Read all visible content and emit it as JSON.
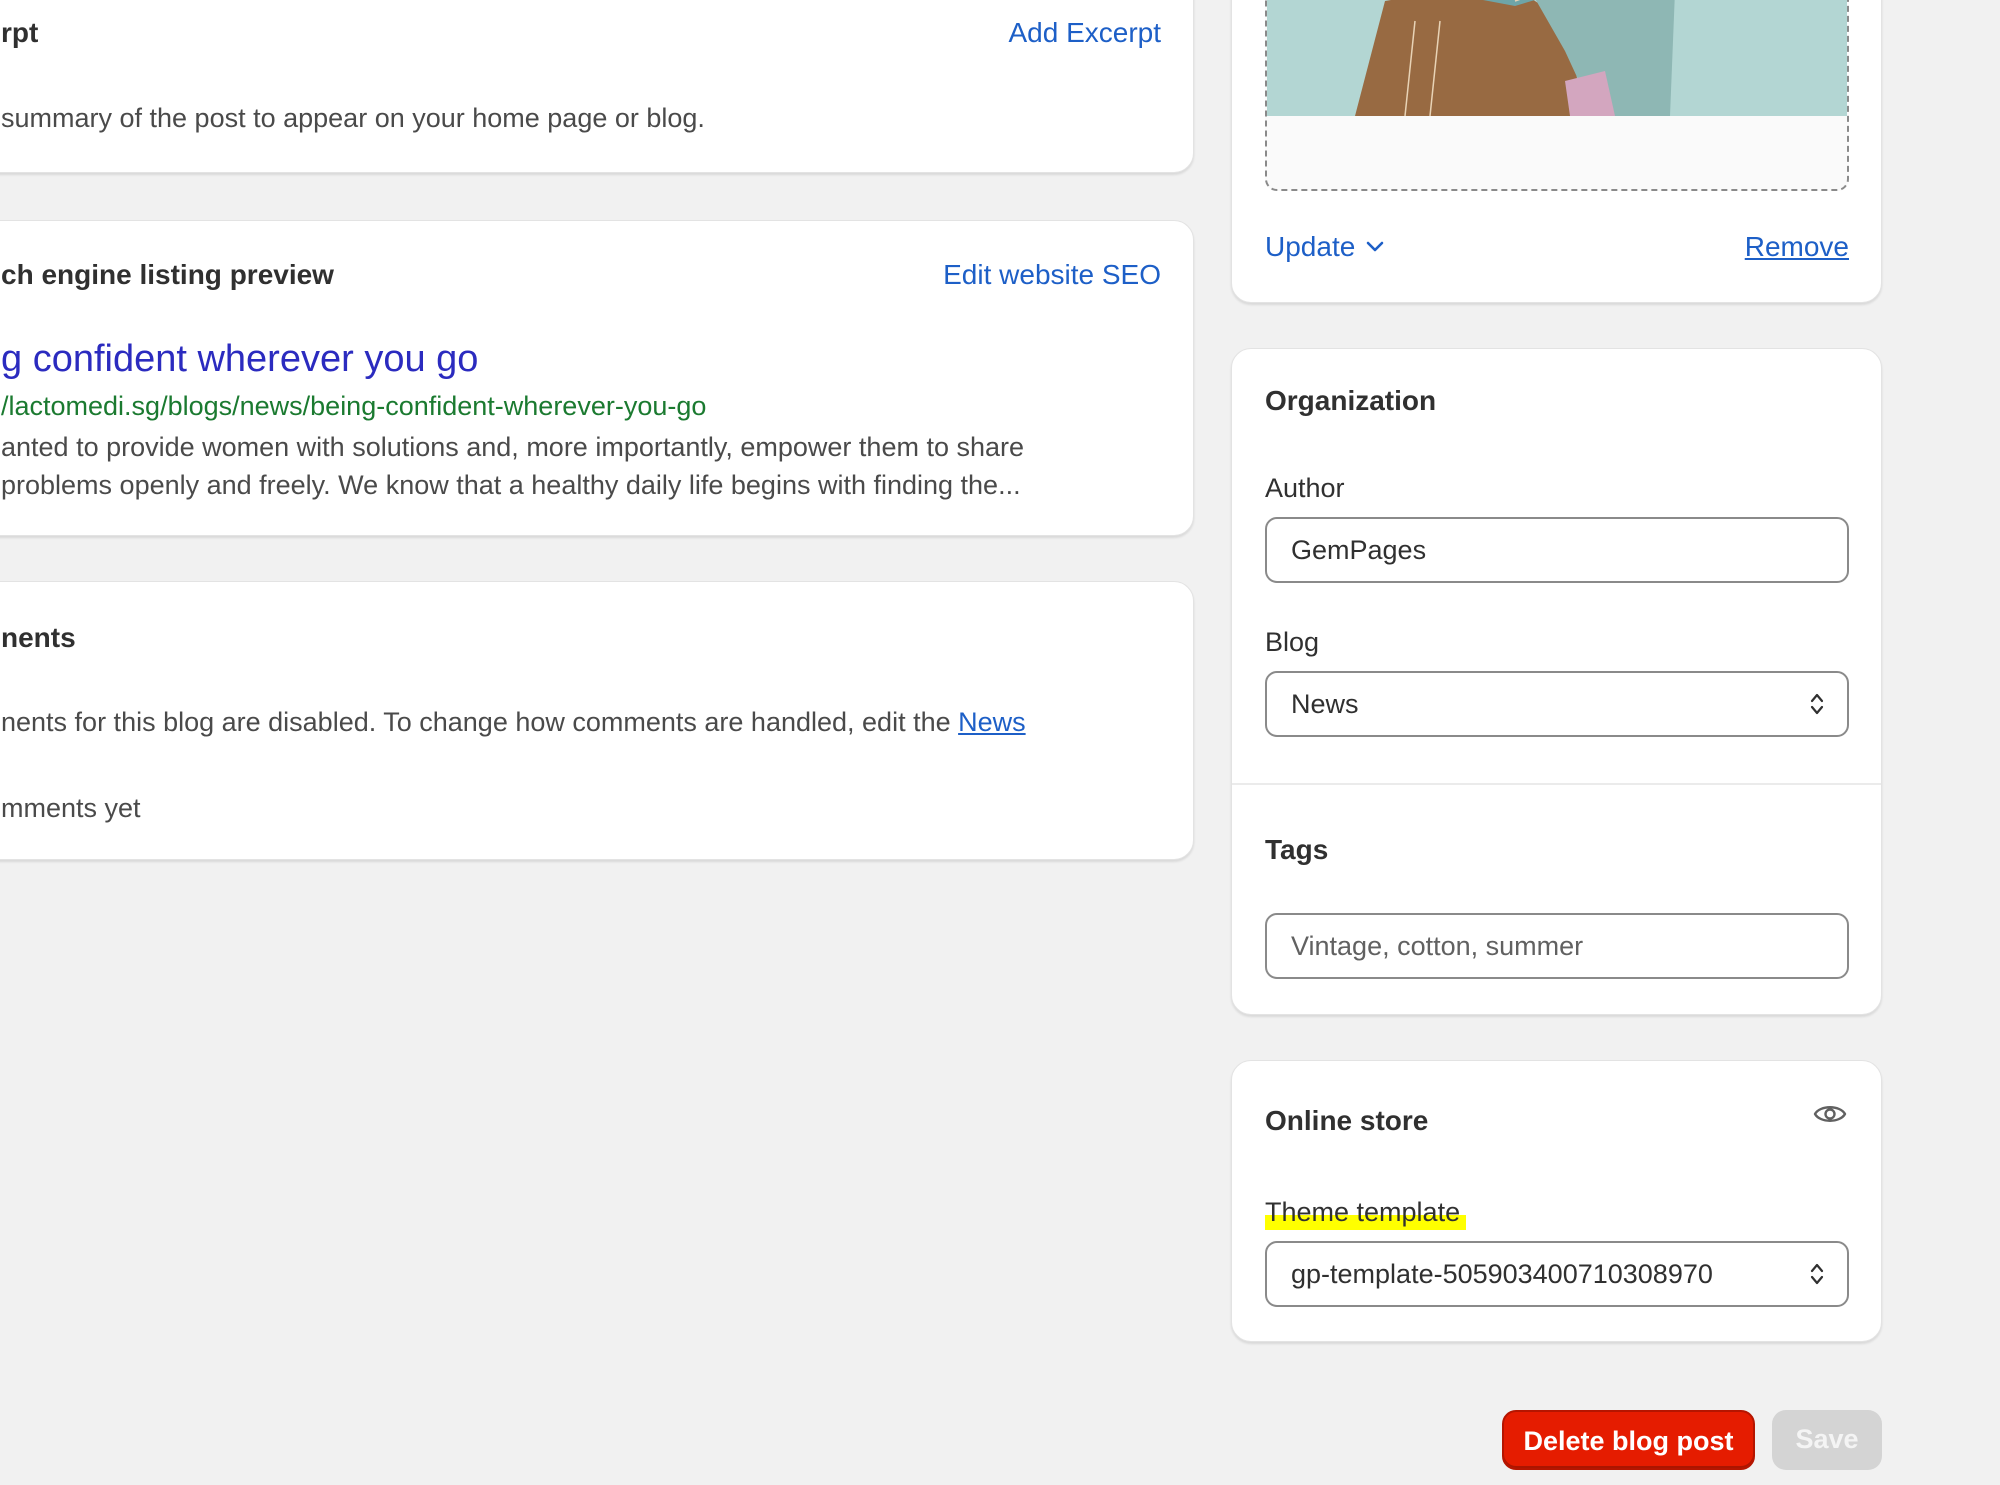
{
  "excerpt": {
    "title": "rpt",
    "action": "Add Excerpt",
    "description": "summary of the post to appear on your home page or blog."
  },
  "seo": {
    "title": "ch engine listing preview",
    "action": "Edit website SEO",
    "preview_title": "g confident wherever you go",
    "preview_url": "/lactomedi.sg/blogs/news/being-confident-wherever-you-go",
    "preview_desc_line1": "anted to provide women with solutions and, more importantly, empower them to share",
    "preview_desc_line2": "problems openly and freely. We know that a healthy daily life begins with finding the..."
  },
  "comments": {
    "title": "nents",
    "disabled_text": "nents for this blog are disabled. To change how comments are handled, edit the ",
    "blog_link": "News",
    "empty_text": "mments yet"
  },
  "image": {
    "update_label": "Update",
    "remove_label": "Remove"
  },
  "organization": {
    "title": "Organization",
    "author_label": "Author",
    "author_value": "GemPages",
    "blog_label": "Blog",
    "blog_value": "News",
    "tags_title": "Tags",
    "tags_placeholder": "Vintage, cotton, summer"
  },
  "online_store": {
    "title": "Online store",
    "theme_label": "Theme template",
    "theme_value": "gp-template-505903400710308970"
  },
  "footer": {
    "delete_label": "Delete blog post",
    "save_label": "Save"
  },
  "colors": {
    "link": "#1d5fc7",
    "seo_title": "#2b2bbf",
    "seo_url": "#1b7a30",
    "delete_bg": "#e51c00",
    "save_bg": "#d4d4d4",
    "highlight": "#ffff00"
  }
}
